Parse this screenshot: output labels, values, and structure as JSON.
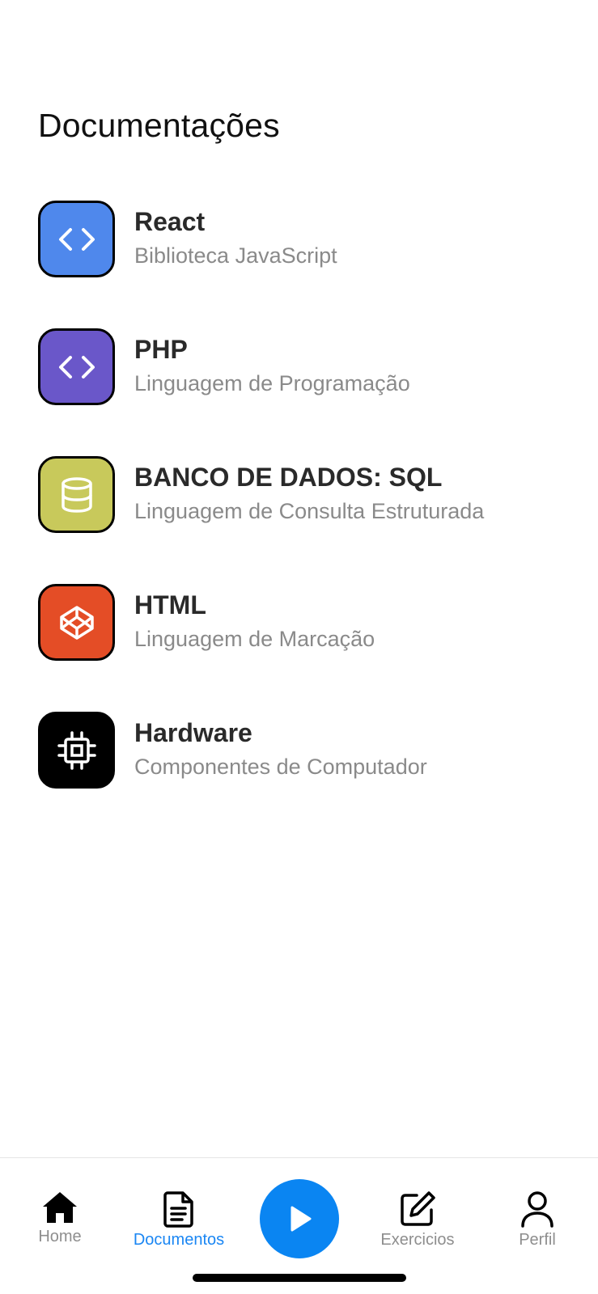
{
  "header": {
    "title": "Documentações"
  },
  "documents": [
    {
      "title": "React",
      "subtitle": "Biblioteca JavaScript",
      "color": "#4f88ec",
      "icon": "code-icon"
    },
    {
      "title": "PHP",
      "subtitle": "Linguagem de Programação",
      "color": "#6a57c9",
      "icon": "code-icon"
    },
    {
      "title": "BANCO DE DADOS: SQL",
      "subtitle": "Linguagem de Consulta Estruturada",
      "color": "#c8c95b",
      "icon": "database-icon"
    },
    {
      "title": "HTML",
      "subtitle": "Linguagem de Marcação",
      "color": "#e44d26",
      "icon": "codepen-icon"
    },
    {
      "title": "Hardware",
      "subtitle": "Componentes de Computador",
      "color": "#000000",
      "icon": "chip-icon"
    }
  ],
  "tabbar": {
    "home": {
      "label": "Home",
      "icon": "home-icon"
    },
    "documents": {
      "label": "Documentos",
      "icon": "document-icon",
      "active": true
    },
    "play": {
      "icon": "play-icon",
      "color": "#0a85f2"
    },
    "exercises": {
      "label": "Exercicios",
      "icon": "edit-icon"
    },
    "profile": {
      "label": "Perfil",
      "icon": "user-icon"
    },
    "active_color": "#1a86f3",
    "inactive_color": "#8e8e8e"
  }
}
